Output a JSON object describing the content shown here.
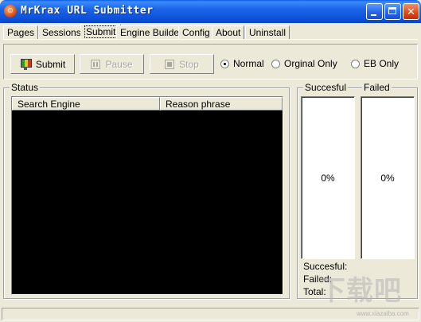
{
  "window": {
    "title": "MrKrax URL Submitter",
    "minimize_label": "_",
    "close_label": "✕"
  },
  "tabs": [
    {
      "label": "Pages",
      "active": false
    },
    {
      "label": "Sessions",
      "active": false
    },
    {
      "label": "Submit",
      "active": true
    },
    {
      "label": "Engine Builder",
      "active": false
    },
    {
      "label": "Config",
      "active": false
    },
    {
      "label": "About",
      "active": false
    },
    {
      "label": "Uninstall",
      "active": false
    }
  ],
  "toolbar": {
    "submit_label": "Submit",
    "pause_label": "Pause",
    "stop_label": "Stop"
  },
  "modes": {
    "options": [
      "Normal",
      "Orginal Only",
      "EB Only"
    ],
    "selected": "Normal"
  },
  "status": {
    "group_label": "Status",
    "columns": [
      "Search Engine",
      "Reason phrase"
    ],
    "rows": []
  },
  "results": {
    "succesful_label": "Succesful",
    "failed_label": "Failed",
    "succesful_percent": "0%",
    "failed_percent": "0%",
    "succesful_count_label": "Succesful:",
    "failed_count_label": "Failed:",
    "total_count_label": "Total:"
  },
  "watermark": {
    "text": "下载吧",
    "url": "www.xiazaiba.com"
  },
  "colors": {
    "face": "#ece9d8",
    "titlebar": "#0b50d8",
    "listview_bg": "#000000",
    "meter_bg": "#ffffff"
  }
}
